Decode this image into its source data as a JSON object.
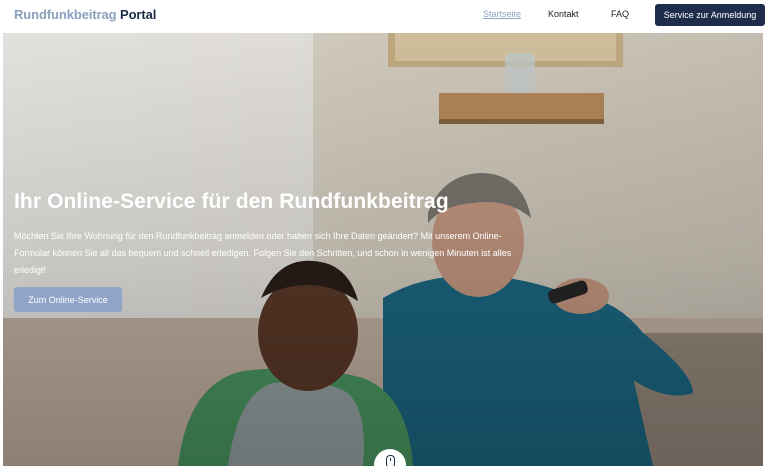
{
  "header": {
    "brand_part1": "Rundfunkbeitrag",
    "brand_part2": "Portal",
    "nav": [
      "Startseite",
      "Kontakt",
      "FAQ"
    ],
    "cta_label": "Service zur Anmeldung"
  },
  "hero": {
    "headline": "Ihr Online-Service für den Rundfunkbeitrag",
    "paragraph": "Möchten Sie Ihre Wohnung für den Rundfunkbeitrag anmelden oder haben sich Ihre Daten geändert? Mit unserem Online-Formular können Sie all das bequem und schnell erledigen. Folgen Sie den Schritten, und schon in wenigen Minuten ist alles erledigt!",
    "button_label": "Zum Online-Service"
  },
  "icons": {
    "scroll": "mouse-scroll-icon"
  },
  "colors": {
    "accent": "#1f2d4d",
    "brand_light": "#8aa0be",
    "button_light": "#8fa4c8"
  }
}
